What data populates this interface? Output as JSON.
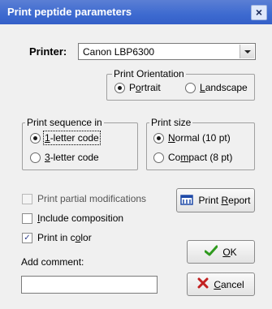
{
  "window": {
    "title": "Print peptide parameters",
    "close_glyph": "×"
  },
  "printer": {
    "label": "Printer:",
    "selected": "Canon LBP6300"
  },
  "orientation": {
    "title": "Print Orientation",
    "portrait": {
      "pre": "P",
      "key": "o",
      "post": "rtrait",
      "checked": true
    },
    "landscape": {
      "pre": "",
      "key": "L",
      "post": "andscape",
      "checked": false
    }
  },
  "sequence": {
    "title": "Print sequence in",
    "one_letter": {
      "pre": "",
      "key": "1",
      "post": "-letter code",
      "checked": true
    },
    "three_letter": {
      "pre": "",
      "key": "3",
      "post": "-letter code",
      "checked": false
    }
  },
  "size": {
    "title": "Print size",
    "normal": {
      "pre": "",
      "key": "N",
      "post": "ormal (10 pt)",
      "checked": true
    },
    "compact": {
      "pre": "Co",
      "key": "m",
      "post": "pact (8 pt)",
      "checked": false
    }
  },
  "options": {
    "partial_mods": {
      "text": "Print partial modifications",
      "checked": false,
      "enabled": false
    },
    "composition": {
      "pre": "",
      "key": "I",
      "post": "nclude composition",
      "checked": false,
      "enabled": true
    },
    "color": {
      "pre": "Print in c",
      "key": "o",
      "post": "lor",
      "checked": true,
      "enabled": true
    }
  },
  "comment": {
    "label": "Add comment:",
    "value": ""
  },
  "buttons": {
    "report": {
      "pre": "Print ",
      "key": "R",
      "post": "eport",
      "icon": "printer-report-icon"
    },
    "ok": {
      "pre": "",
      "key": "O",
      "post": "K",
      "icon": "checkmark-icon"
    },
    "cancel": {
      "pre": "",
      "key": "C",
      "post": "ancel",
      "icon": "cross-icon"
    }
  },
  "colors": {
    "title_bar": "#3d6ad0",
    "ok_icon": "#2f9a1e",
    "cancel_icon": "#c22020",
    "report_icon": "#1f4aa8"
  }
}
